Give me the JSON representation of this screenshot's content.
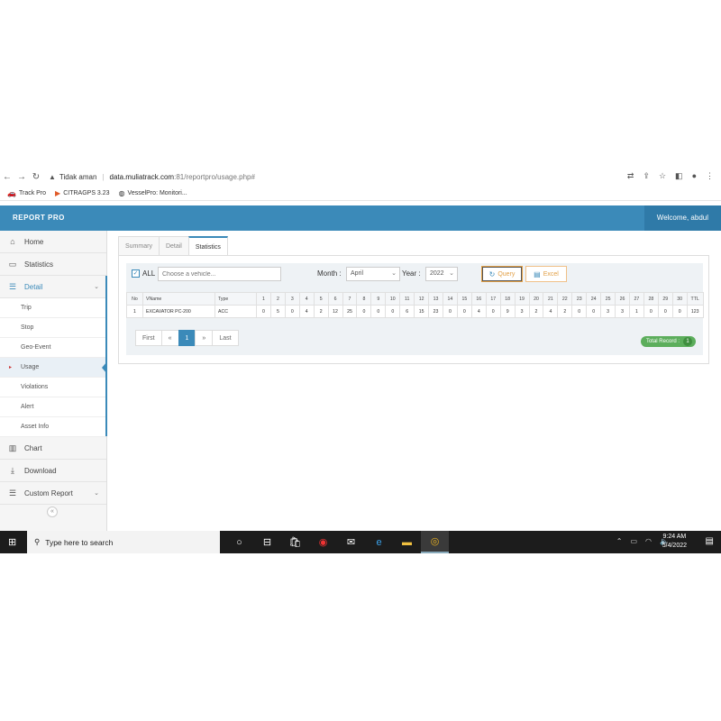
{
  "browser": {
    "warning": "Tidak aman",
    "url_host": "data.muliatrack.com",
    "url_rest": ":81/reportpro/usage.php#",
    "bookmarks": [
      "Track Pro",
      "CITRAGPS 3.23",
      "VesselPro: Monitori..."
    ]
  },
  "app": {
    "logo": "REPORT PRO",
    "welcome": "Welcome, abdul"
  },
  "sidebar": {
    "items": [
      {
        "label": "Home",
        "icon": "home-icon"
      },
      {
        "label": "Statistics",
        "icon": "monitor-icon"
      },
      {
        "label": "Detail",
        "icon": "list-icon"
      }
    ],
    "detail_sub": [
      "Trip",
      "Stop",
      "Geo-Event",
      "Usage",
      "Violations",
      "Alert",
      "Asset Info"
    ],
    "bottom_items": [
      {
        "label": "Chart",
        "icon": "bar-chart-icon"
      },
      {
        "label": "Download",
        "icon": "download-icon"
      },
      {
        "label": "Custom Report",
        "icon": "list-icon"
      }
    ],
    "collapse": "«"
  },
  "tabs": [
    "Summary",
    "Detail",
    "Statistics"
  ],
  "filters": {
    "all_label": "ALL",
    "vehicle_placeholder": "Choose a vehicle...",
    "month_label": "Month :",
    "month_value": "April",
    "year_label": "Year :",
    "year_value": "2022",
    "query_label": "Query",
    "excel_label": "Excel"
  },
  "table": {
    "headers": [
      "No",
      "VName",
      "Type",
      "1",
      "2",
      "3",
      "4",
      "5",
      "6",
      "7",
      "8",
      "9",
      "10",
      "11",
      "12",
      "13",
      "14",
      "15",
      "16",
      "17",
      "18",
      "19",
      "20",
      "21",
      "22",
      "23",
      "24",
      "25",
      "26",
      "27",
      "28",
      "29",
      "30",
      "TTL"
    ],
    "rows": [
      [
        "1",
        "EXCAVATOR PC-200",
        "ACC",
        "0",
        "5",
        "0",
        "4",
        "2",
        "12",
        "25",
        "0",
        "0",
        "0",
        "6",
        "15",
        "23",
        "0",
        "0",
        "4",
        "0",
        "9",
        "3",
        "2",
        "4",
        "2",
        "0",
        "0",
        "3",
        "3",
        "1",
        "0",
        "0",
        "0",
        "123"
      ]
    ]
  },
  "pager": {
    "first": "First",
    "prev": "«",
    "current": "1",
    "next": "»",
    "last": "Last"
  },
  "total_record": {
    "label": "Total Record :",
    "count": "1"
  },
  "taskbar": {
    "search_placeholder": "Type here to search",
    "time": "9:24 AM",
    "date": "5/4/2022"
  }
}
